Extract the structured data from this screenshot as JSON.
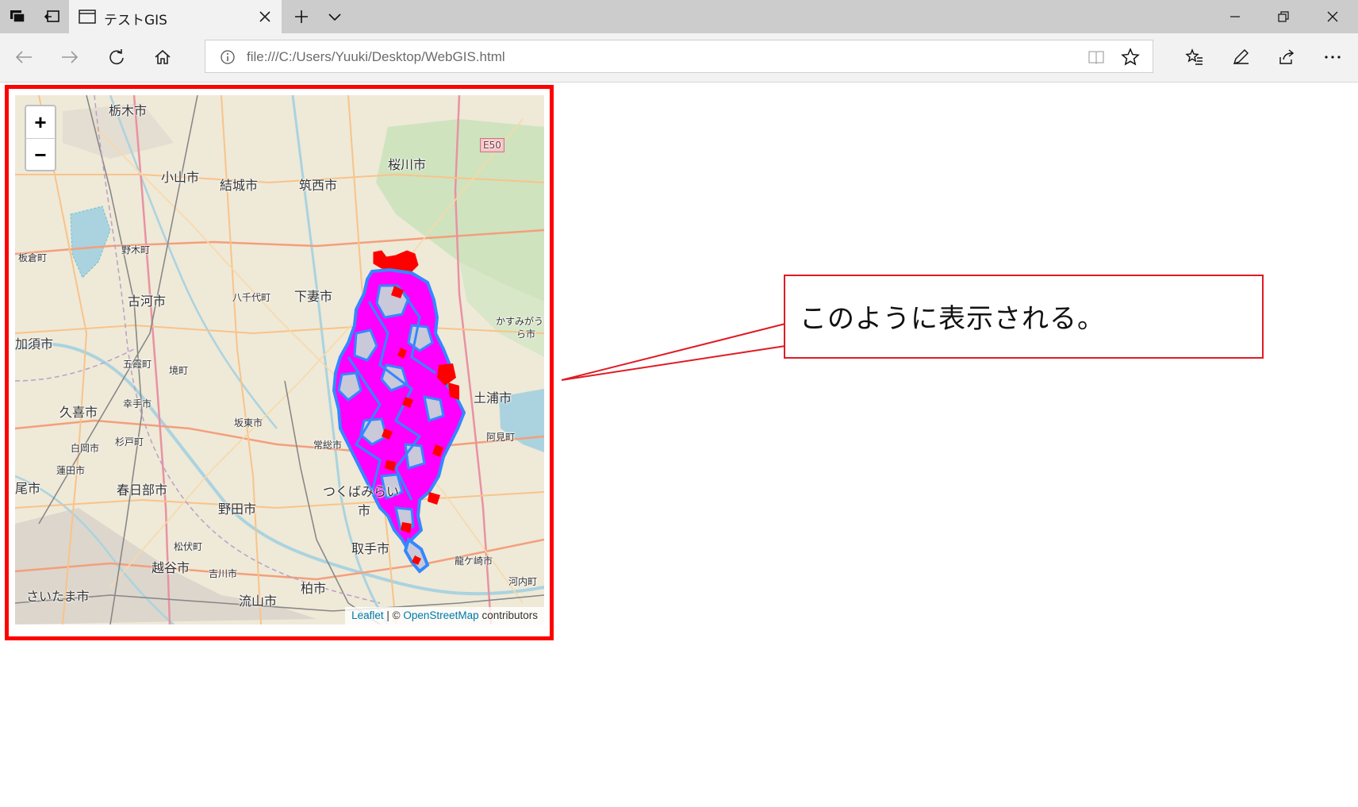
{
  "browser": {
    "tab_title": "テストGIS",
    "url": "file:///C:/Users/Yuuki/Desktop/WebGIS.html"
  },
  "map": {
    "zoom_in": "+",
    "zoom_out": "−",
    "attribution": {
      "leaflet": "Leaflet",
      "separator": " | © ",
      "osm": "OpenStreetMap",
      "suffix": " contributors"
    },
    "places": [
      {
        "name": "栃木市"
      },
      {
        "name": "小山市"
      },
      {
        "name": "結城市"
      },
      {
        "name": "筑西市"
      },
      {
        "name": "桜川市"
      },
      {
        "name": "E50"
      },
      {
        "name": "板倉町"
      },
      {
        "name": "野木町"
      },
      {
        "name": "古河市"
      },
      {
        "name": "八千代町"
      },
      {
        "name": "下妻市"
      },
      {
        "name": "かすみがう"
      },
      {
        "name": "ら市"
      },
      {
        "name": "加須市"
      },
      {
        "name": "五霞町"
      },
      {
        "name": "境町"
      },
      {
        "name": "幸手市"
      },
      {
        "name": "久喜市"
      },
      {
        "name": "坂東市"
      },
      {
        "name": "土浦市"
      },
      {
        "name": "白岡市"
      },
      {
        "name": "杉戸町"
      },
      {
        "name": "常総市"
      },
      {
        "name": "阿見町"
      },
      {
        "name": "蓮田市"
      },
      {
        "name": "尾市"
      },
      {
        "name": "春日部市"
      },
      {
        "name": "つくばみらい"
      },
      {
        "name": "市"
      },
      {
        "name": "野田市"
      },
      {
        "name": "松伏町"
      },
      {
        "name": "取手市"
      },
      {
        "name": "龍ケ崎市"
      },
      {
        "name": "越谷市"
      },
      {
        "name": "吉川市"
      },
      {
        "name": "河内町"
      },
      {
        "name": "柏市"
      },
      {
        "name": "さいたま市"
      },
      {
        "name": "流山市"
      }
    ]
  },
  "callout": {
    "text": "このように表示される。"
  },
  "colors": {
    "frame": "#ff0000",
    "polygon_fill": "#ff00ff",
    "polygon_stroke": "#3388ff",
    "polygon_red": "#ff0000",
    "link": "#0078a8"
  }
}
